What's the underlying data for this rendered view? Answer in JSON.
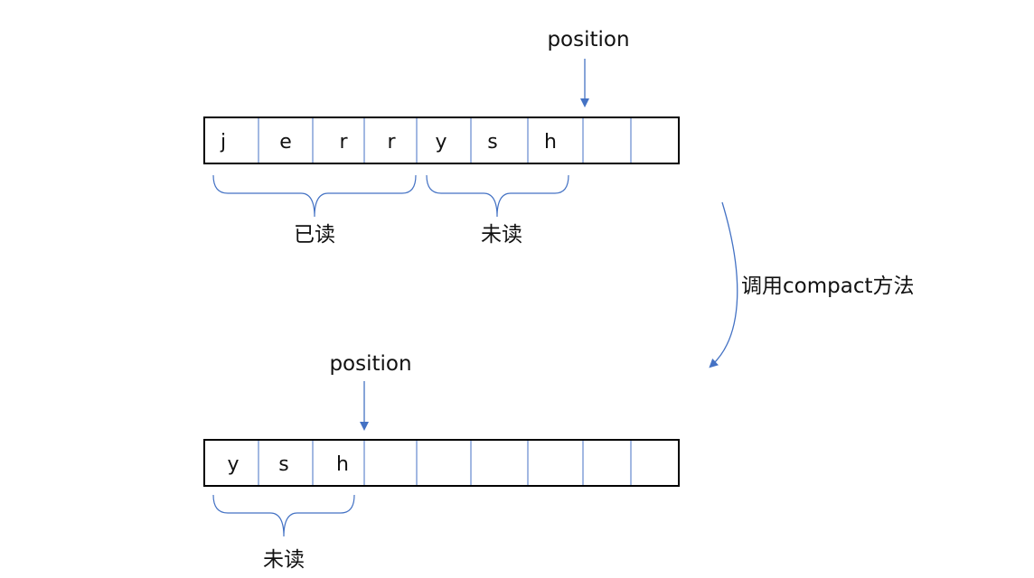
{
  "colors": {
    "line": "#4472c4",
    "border": "#000000",
    "text": "#111111"
  },
  "top": {
    "pointer_label": "position",
    "cells": [
      "j",
      "e",
      "r",
      "r",
      "y",
      "s",
      "h",
      "",
      ""
    ],
    "brace_read_label": "已读",
    "brace_unread_label": "未读"
  },
  "transition": {
    "label": "调用compact方法"
  },
  "bottom": {
    "pointer_label": "position",
    "cells": [
      "y",
      "s",
      "h",
      "",
      "",
      "",
      "",
      "",
      ""
    ],
    "brace_unread_label": "未读"
  }
}
